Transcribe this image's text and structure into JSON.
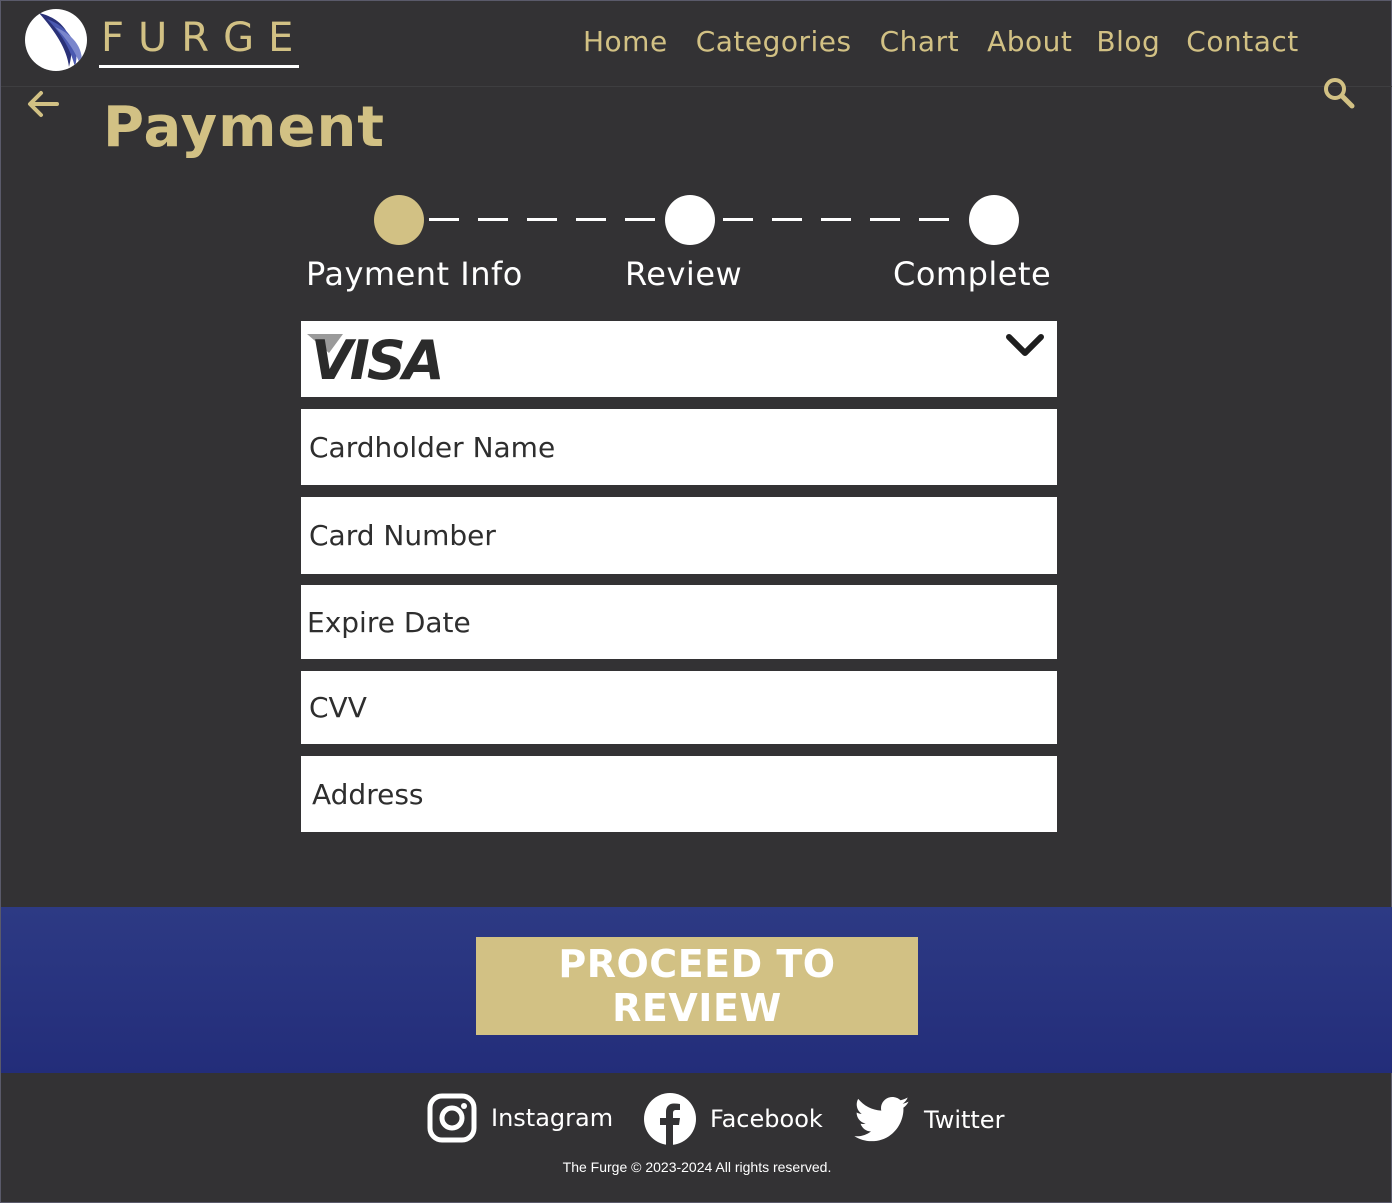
{
  "brand": {
    "name": "FURGE"
  },
  "nav": {
    "items": [
      {
        "label": "Home"
      },
      {
        "label": "Categories"
      },
      {
        "label": "Chart"
      },
      {
        "label": "About"
      },
      {
        "label": "Blog"
      },
      {
        "label": "Contact"
      }
    ]
  },
  "page": {
    "title": "Payment"
  },
  "steps": [
    {
      "label": "Payment Info",
      "state": "active"
    },
    {
      "label": "Review",
      "state": "pending"
    },
    {
      "label": "Complete",
      "state": "pending"
    }
  ],
  "form": {
    "card_type": {
      "selected": "VISA"
    },
    "cardholder_placeholder": "Cardholder Name",
    "card_number_placeholder": "Card Number",
    "expire_placeholder": "Expire Date",
    "cvv_placeholder": "CVV",
    "address_placeholder": "Address"
  },
  "actions": {
    "proceed_label": "PROCEED TO REVIEW"
  },
  "footer": {
    "social": [
      {
        "label": "Instagram",
        "icon": "instagram-icon"
      },
      {
        "label": "Facebook",
        "icon": "facebook-icon"
      },
      {
        "label": "Twitter",
        "icon": "twitter-icon"
      }
    ],
    "copyright": "The Furge © 2023-2024 All rights reserved."
  },
  "colors": {
    "background": "#333234",
    "accent_gold": "#d2c184",
    "band_blue": "#2d3a84",
    "white": "#ffffff"
  }
}
